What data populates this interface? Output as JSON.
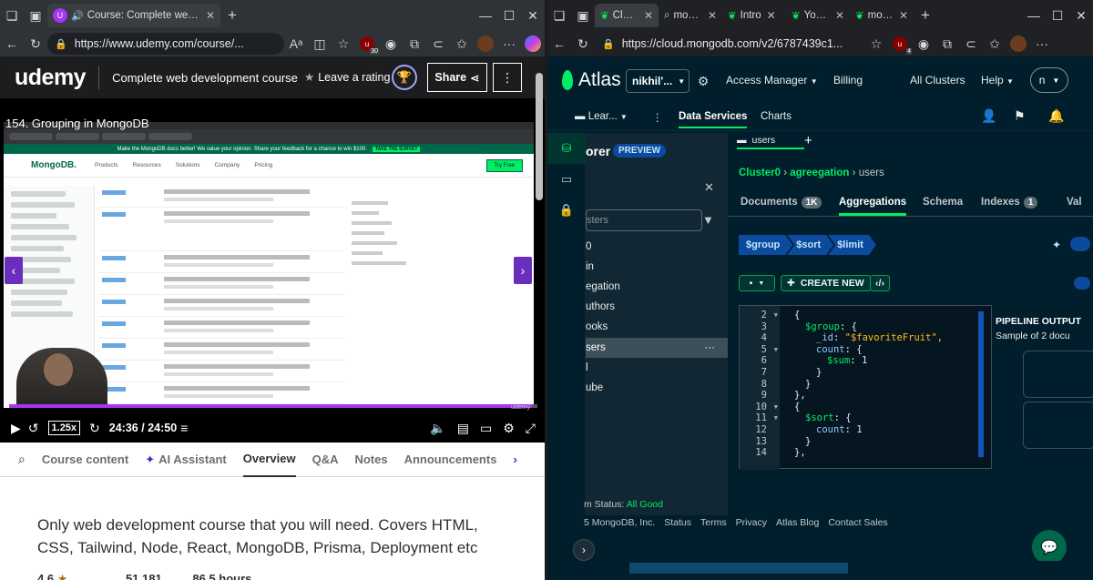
{
  "left": {
    "tabs": [
      {
        "title": "Course: Complete web devel",
        "active": true
      }
    ],
    "url": "https://www.udemy.com/course/...",
    "ext_badge": "30",
    "udemy": {
      "logo": "udemy",
      "course_title": "Complete web development course",
      "leave_rating": "Leave a rating",
      "share": "Share"
    },
    "video": {
      "lecture_title": "154. Grouping in MongoDB",
      "speed": "1.25x",
      "time": "24:36 / 24:50",
      "progress_fraction": 0.99,
      "inner_banner": "Make the MongoDB docs better! We value your opinion. Share your feedback for a chance to win $100.",
      "inner_banner_btn": "TAKE THE SURVEY",
      "inner_logo": "MongoDB.",
      "inner_nav": [
        "Products",
        "Resources",
        "Solutions",
        "Company",
        "Pricing"
      ],
      "inner_try": "Try Free",
      "watermark": "udemy"
    },
    "tabs_row": [
      "Course content",
      "AI Assistant",
      "Overview",
      "Q&A",
      "Notes",
      "Announcements"
    ],
    "active_tab": "Overview",
    "description": "Only web development course that you will need. Covers HTML, CSS, Tailwind, Node, React, MongoDB, Prisma, Deployment etc",
    "stats": [
      "4.6",
      "51,181",
      "86.5 hours"
    ]
  },
  "right": {
    "tabs": [
      "Cluste",
      "mongo",
      "Intro",
      "You A",
      "mong"
    ],
    "url": "https://cloud.mongodb.com/v2/6787439c1...",
    "ext_badge": "4",
    "atlas": {
      "logo": "Atlas",
      "project": "nikhil'...",
      "access_manager": "Access Manager",
      "billing": "Billing",
      "all_clusters": "All Clusters",
      "help": "Help",
      "avatar": "n",
      "sub_nav": {
        "learn": "Lear...",
        "data_services": "Data Services",
        "charts": "Charts"
      }
    },
    "explorer": {
      "title": "orer",
      "preview": "PREVIEW",
      "search_placeholder": "sters",
      "items": [
        "0",
        "in",
        "egation",
        "uthors",
        "ooks",
        "sers",
        "l",
        "ube"
      ],
      "selected": "sers"
    },
    "main": {
      "collection_tab": "users",
      "breadcrumb": [
        "Cluster0",
        "agreegation",
        "users"
      ],
      "tabs": [
        {
          "label": "Documents",
          "badge": "1K"
        },
        {
          "label": "Aggregations",
          "badge": ""
        },
        {
          "label": "Schema",
          "badge": ""
        },
        {
          "label": "Indexes",
          "badge": "1"
        },
        {
          "label": "Val",
          "badge": ""
        }
      ],
      "active_tab": "Aggregations",
      "stages": [
        "$group",
        "$sort",
        "$limit"
      ],
      "create_new": "CREATE NEW",
      "code_lines": [
        {
          "n": "2",
          "fold": true,
          "text": "{",
          "indent": 0
        },
        {
          "n": "3",
          "fold": false,
          "text": "$group: {",
          "indent": 1
        },
        {
          "n": "4",
          "fold": false,
          "text": "_id: \"$favoriteFruit\",",
          "indent": 2
        },
        {
          "n": "5",
          "fold": true,
          "text": "count: {",
          "indent": 2
        },
        {
          "n": "6",
          "fold": false,
          "text": "$sum: 1",
          "indent": 3
        },
        {
          "n": "7",
          "fold": false,
          "text": "}",
          "indent": 2
        },
        {
          "n": "8",
          "fold": false,
          "text": "}",
          "indent": 1
        },
        {
          "n": "9",
          "fold": false,
          "text": "},",
          "indent": 0
        },
        {
          "n": "10",
          "fold": true,
          "text": "{",
          "indent": 0
        },
        {
          "n": "11",
          "fold": true,
          "text": "$sort: {",
          "indent": 1
        },
        {
          "n": "12",
          "fold": false,
          "text": "count: 1",
          "indent": 2
        },
        {
          "n": "13",
          "fold": false,
          "text": "}",
          "indent": 1
        },
        {
          "n": "14",
          "fold": false,
          "text": "},",
          "indent": 0
        }
      ],
      "output_title": "PIPELINE OUTPUT",
      "output_sub": "Sample of 2 docu"
    },
    "footer": {
      "status_label": "m Status:",
      "status_value": "All Good",
      "links": [
        "5 MongoDB, Inc.",
        "Status",
        "Terms",
        "Privacy",
        "Atlas Blog",
        "Contact Sales"
      ]
    }
  }
}
